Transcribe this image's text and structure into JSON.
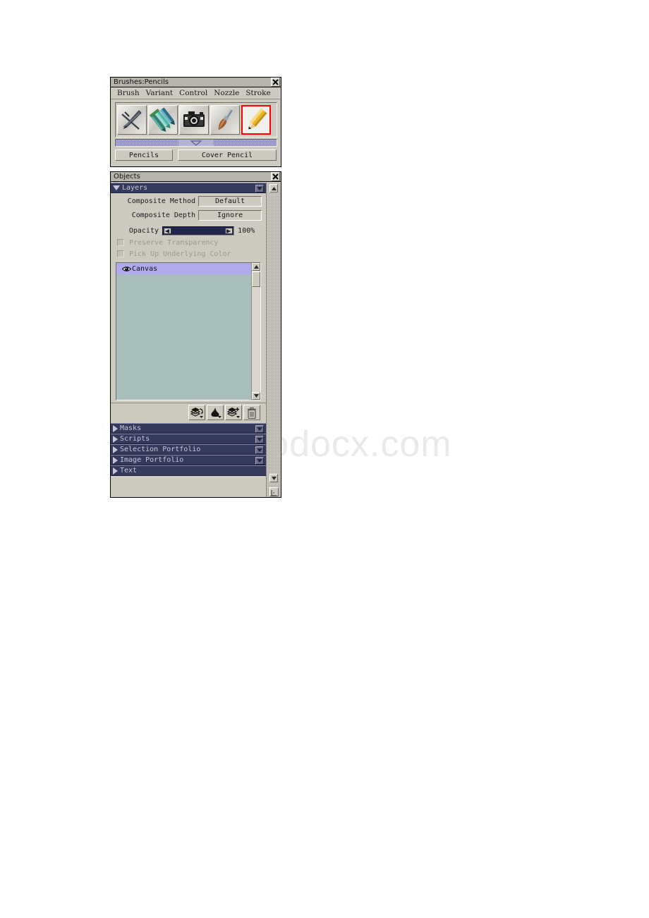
{
  "watermark": {
    "text": "www.bodocx.com"
  },
  "brushes_palette": {
    "title": "Brushes:Pencils",
    "close_icon": "close-icon",
    "menu": [
      {
        "label": "Brush"
      },
      {
        "label": "Variant"
      },
      {
        "label": "Control"
      },
      {
        "label": "Nozzle"
      },
      {
        "label": "Stroke"
      }
    ],
    "brush_icons": [
      {
        "name": "brush-category-pens",
        "selected": false
      },
      {
        "name": "brush-category-felt-pens",
        "selected": false
      },
      {
        "name": "brush-category-photo",
        "selected": false
      },
      {
        "name": "brush-category-artists",
        "selected": false
      },
      {
        "name": "brush-category-pencils",
        "selected": true
      }
    ],
    "tabs": [
      {
        "label": "Pencils"
      },
      {
        "label": "Cover Pencil"
      }
    ]
  },
  "objects_palette": {
    "title": "Objects",
    "close_icon": "close-icon",
    "layers_section": {
      "label": "Layers",
      "expanded": true,
      "menu_icon": "section-menu-icon",
      "composite_method": {
        "label": "Composite Method",
        "value": "Default"
      },
      "composite_depth": {
        "label": "Composite Depth",
        "value": "Ignore"
      },
      "opacity": {
        "label": "Opacity",
        "value": "100%",
        "percent": 100
      },
      "checkboxes": [
        {
          "label": "Preserve Transparency",
          "checked": false,
          "disabled": true
        },
        {
          "label": "Pick Up Underlying Color",
          "checked": false,
          "disabled": true
        }
      ],
      "layers": [
        {
          "name": "Canvas",
          "visible": true,
          "selected": true
        }
      ],
      "toolbar": [
        {
          "name": "layer-options-button"
        },
        {
          "name": "dynamic-plugin-button"
        },
        {
          "name": "new-layer-button"
        },
        {
          "name": "delete-layer-button"
        }
      ]
    },
    "sections": [
      {
        "label": "Masks",
        "expanded": false,
        "has_menu": true
      },
      {
        "label": "Scripts",
        "expanded": false,
        "has_menu": true
      },
      {
        "label": "Selection Portfolio",
        "expanded": false,
        "has_menu": true
      },
      {
        "label": "Image Portfolio",
        "expanded": false,
        "has_menu": true
      },
      {
        "label": "Text",
        "expanded": false,
        "has_menu": false
      }
    ]
  }
}
